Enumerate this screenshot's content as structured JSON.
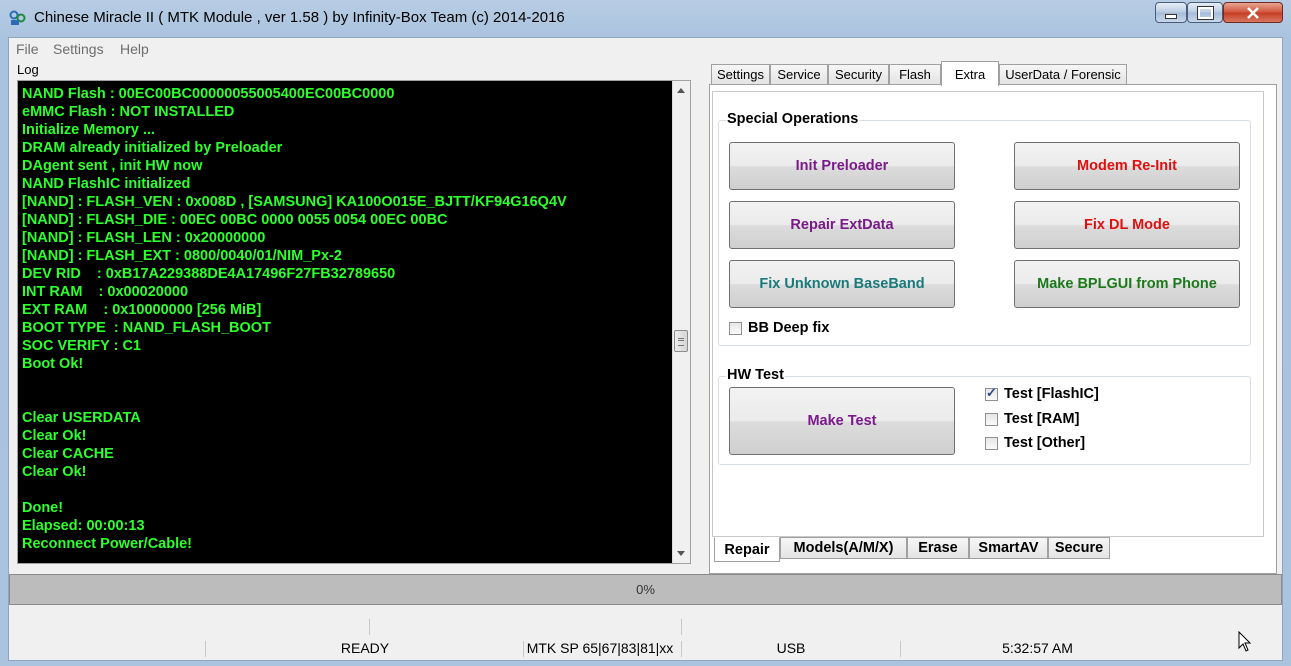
{
  "window": {
    "title": "Chinese Miracle II ( MTK Module , ver 1.58 ) by Infinity-Box Team (c) 2014-2016"
  },
  "menu": {
    "items": [
      "File",
      "Settings",
      "Help"
    ]
  },
  "log": {
    "label": "Log",
    "text_color": "#2dff2d",
    "lines": [
      "NAND Flash : 00EC00BC00000055005400EC00BC0000",
      "eMMC Flash : NOT INSTALLED",
      "Initialize Memory ...",
      "DRAM already initialized by Preloader",
      "DAgent sent , init HW now",
      "NAND FlashIC initialized",
      "[NAND] : FLASH_VEN : 0x008D , [SAMSUNG] KA100O015E_BJTT/KF94G16Q4V",
      "[NAND] : FLASH_DIE : 00EC 00BC 0000 0055 0054 00EC 00BC",
      "[NAND] : FLASH_LEN : 0x20000000",
      "[NAND] : FLASH_EXT : 0800/0040/01/NIM_Px-2",
      "DEV RID    : 0xB17A229388DE4A17496F27FB32789650",
      "INT RAM    : 0x00020000",
      "EXT RAM    : 0x10000000 [256 MiB]",
      "BOOT TYPE  : NAND_FLASH_BOOT",
      "SOC VERIFY : C1",
      "Boot Ok!",
      "",
      "",
      "Clear USERDATA",
      "Clear Ok!",
      "Clear CACHE",
      "Clear Ok!",
      "",
      "Done!",
      "Elapsed: 00:00:13",
      "Reconnect Power/Cable!"
    ]
  },
  "top_tabs": {
    "items": [
      "Settings",
      "Service",
      "Security",
      "Flash",
      "Extra",
      "UserData / Forensic"
    ],
    "active": "Extra"
  },
  "special_operations": {
    "title": "Special Operations",
    "buttons": {
      "init_preloader": {
        "label": "Init Preloader",
        "color": "#7a1a8a"
      },
      "modem_reinit": {
        "label": "Modem Re-Init",
        "color": "#e01010"
      },
      "repair_extdata": {
        "label": "Repair ExtData",
        "color": "#7a1a8a"
      },
      "fix_dl_mode": {
        "label": "Fix DL Mode",
        "color": "#e01010"
      },
      "fix_unknown_baseband": {
        "label": "Fix Unknown BaseBand",
        "color": "#1a7a7a"
      },
      "make_bplgui": {
        "label": "Make BPLGUI from Phone",
        "color": "#1a7a1a"
      }
    },
    "bb_deep_fix": {
      "label": "BB Deep fix",
      "checked": false
    }
  },
  "hw_test": {
    "title": "HW Test",
    "make_test": {
      "label": "Make Test",
      "color": "#7a1a8a"
    },
    "checks": [
      {
        "label": "Test [FlashIC]",
        "checked": true
      },
      {
        "label": "Test [RAM]",
        "checked": false
      },
      {
        "label": "Test [Other]",
        "checked": false
      }
    ]
  },
  "bottom_tabs": {
    "items": [
      "Repair",
      "Models(A/M/X)",
      "Erase",
      "SmartAV",
      "Secure"
    ],
    "active": "Repair"
  },
  "progress": {
    "text": "0%",
    "value": 0
  },
  "status": {
    "state": "READY",
    "platform": "MTK SP 65|67|83|81|xx",
    "port": "USB",
    "time": "5:32:57 AM"
  }
}
